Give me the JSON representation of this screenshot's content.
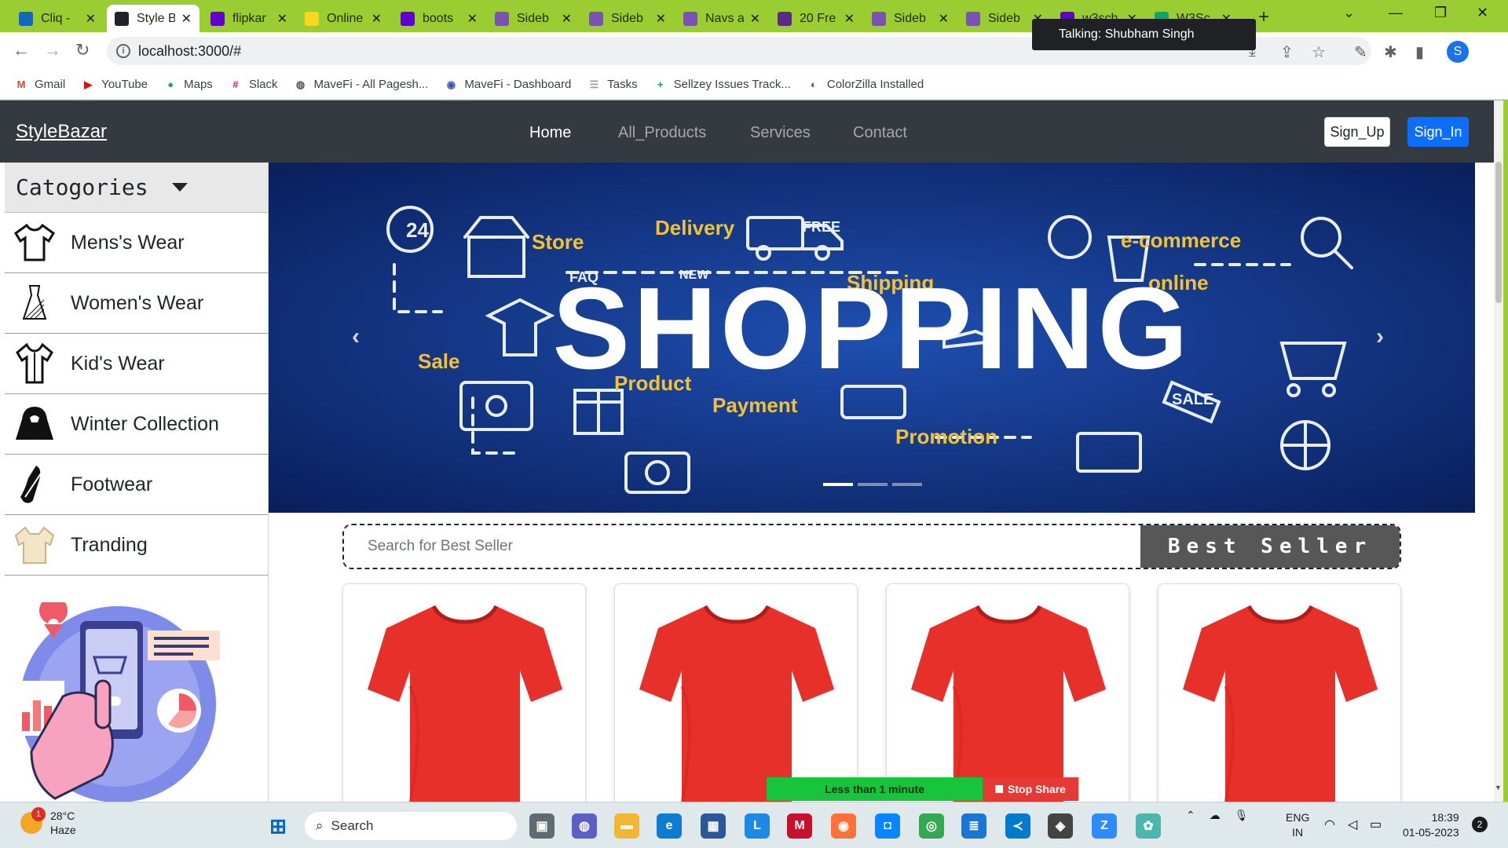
{
  "tabs": [
    {
      "title": "Cliq -",
      "icon": "cliq-icon",
      "color": "#1565c0"
    },
    {
      "title": "Style B",
      "icon": "react-icon",
      "color": "#20232a",
      "active": true
    },
    {
      "title": "flipkar",
      "icon": "yahoo-icon",
      "color": "#6001d2"
    },
    {
      "title": "Online",
      "icon": "flipkart-icon",
      "color": "#f9d71c"
    },
    {
      "title": "boots",
      "icon": "yahoo-icon",
      "color": "#6001d2"
    },
    {
      "title": "Sideb",
      "icon": "bootstrap-icon",
      "color": "#7952b3"
    },
    {
      "title": "Sideb",
      "icon": "bootstrap-icon",
      "color": "#7952b3"
    },
    {
      "title": "Navs a",
      "icon": "bootstrap-icon",
      "color": "#7952b3"
    },
    {
      "title": "20 Fre",
      "icon": "colorlib-icon",
      "color": "#5b2a86"
    },
    {
      "title": "Sideb",
      "icon": "bootstrap-icon",
      "color": "#7952b3"
    },
    {
      "title": "Sideb",
      "icon": "bootstrap-icon",
      "color": "#7952b3"
    },
    {
      "title": "w3sch",
      "icon": "yahoo-icon",
      "color": "#6001d2"
    },
    {
      "title": "W3Sc",
      "icon": "w3-icon",
      "color": "#04aa6d"
    }
  ],
  "tooltip": "Talking: Shubham Singh",
  "address": "localhost:3000/#",
  "profile_initial": "S",
  "bookmarks": [
    {
      "label": "Gmail",
      "icon": "gmail-icon",
      "glyph": "M",
      "color": "#ea4335"
    },
    {
      "label": "YouTube",
      "icon": "youtube-icon",
      "glyph": "▶",
      "color": "#ff0000"
    },
    {
      "label": "Maps",
      "icon": "maps-icon",
      "glyph": "●",
      "color": "#34a853"
    },
    {
      "label": "Slack",
      "icon": "slack-icon",
      "glyph": "#",
      "color": "#e01e5a"
    },
    {
      "label": "MaveFi - All Pagesh...",
      "icon": "globe-icon",
      "glyph": "◍",
      "color": "#555555"
    },
    {
      "label": "MaveFi - Dashboard",
      "icon": "mavefi-icon",
      "glyph": "◉",
      "color": "#3f51b5"
    },
    {
      "label": "Tasks",
      "icon": "tasks-icon",
      "glyph": "☰",
      "color": "#9e9e9e"
    },
    {
      "label": "Sellzey Issues Track...",
      "icon": "sheets-icon",
      "glyph": "+",
      "color": "#0f9d58"
    },
    {
      "label": "ColorZilla Installed",
      "icon": "colorzilla-icon",
      "glyph": "◐",
      "color": "#c2185b"
    }
  ],
  "site": {
    "brand": "StyleBazar",
    "nav": [
      "Home",
      "All_Products",
      "Services",
      "Contact"
    ],
    "signup": "Sign_Up",
    "signin": "Sign_In"
  },
  "sidebar": {
    "heading": "Catogories",
    "items": [
      {
        "label": "Mens's Wear",
        "icon": "tshirt-icon"
      },
      {
        "label": "Women's Wear",
        "icon": "dress-icon"
      },
      {
        "label": "Kid's Wear",
        "icon": "kids-shirt-icon"
      },
      {
        "label": "Winter Collection",
        "icon": "jacket-icon"
      },
      {
        "label": "Footwear",
        "icon": "shoe-icon"
      },
      {
        "label": "Tranding",
        "icon": "trending-shirt-icon"
      }
    ]
  },
  "banner": {
    "headline": "SHOPPING",
    "words": [
      "Store",
      "Delivery",
      "FREE",
      "e-commerce",
      "Shipping",
      "online",
      "Sale",
      "Product",
      "Payment",
      "Promotion",
      "FAQ",
      "NEW",
      "SALE",
      "24"
    ],
    "slides": 3,
    "active_slide": 1,
    "bg_color": "#0f2e7a"
  },
  "bestseller": {
    "placeholder": "Search for Best Seller",
    "button": "Best Seller",
    "product_color": "#e8302b"
  },
  "share": {
    "timer": "Less than 1 minute",
    "stop": "Stop Share"
  },
  "taskbar": {
    "temp": "28°C",
    "weather": "Haze",
    "weather_badge": "1",
    "search": "Search",
    "lang1": "ENG",
    "lang2": "IN",
    "time": "18:39",
    "date": "01-05-2023",
    "notif": "2"
  }
}
